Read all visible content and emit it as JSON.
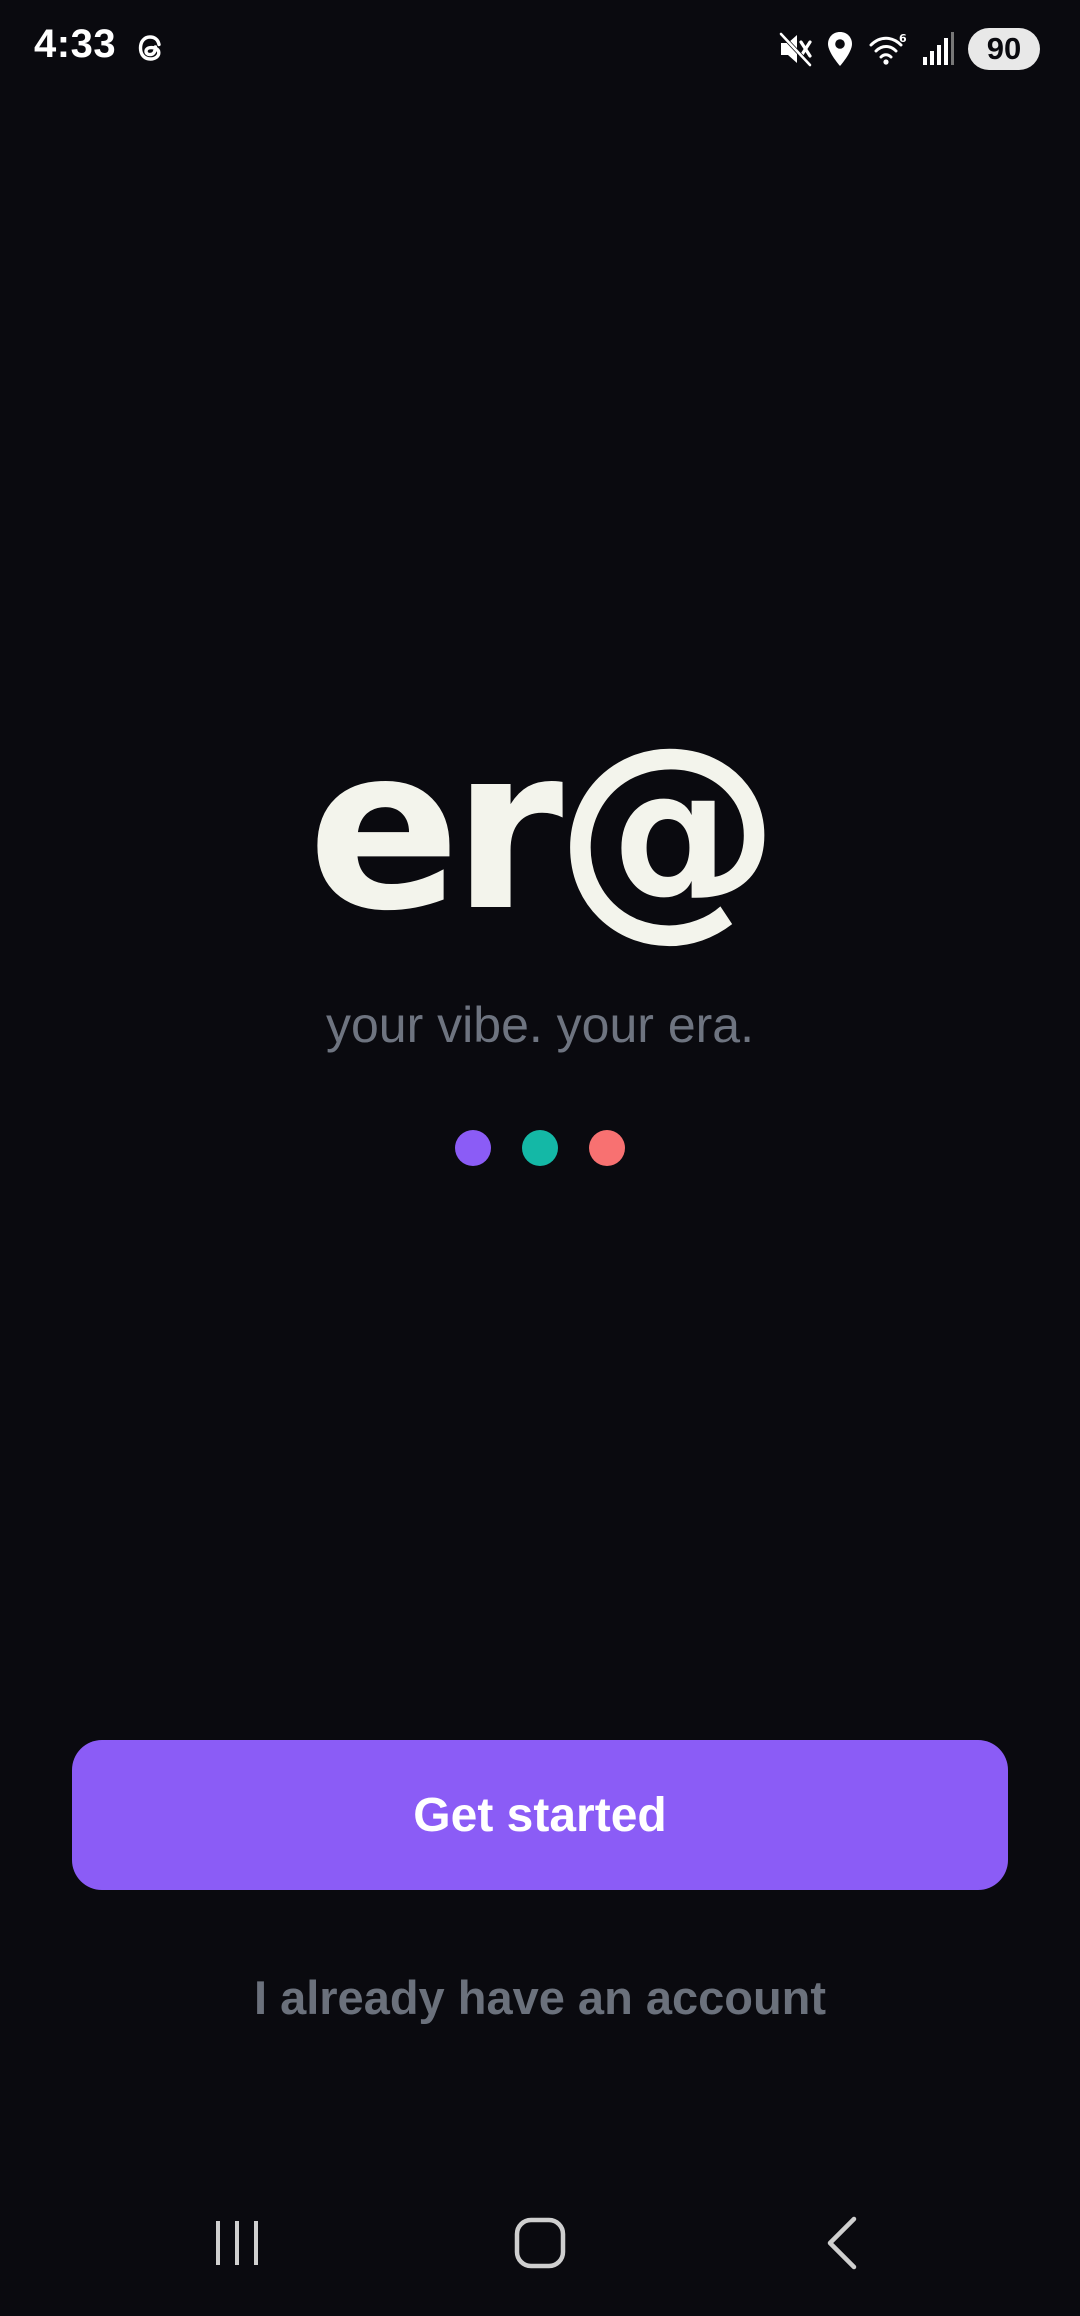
{
  "status_bar": {
    "time": "4:33",
    "battery": "90",
    "icons": [
      "threads-icon",
      "mute-icon",
      "location-icon",
      "wifi-icon",
      "signal-icon"
    ]
  },
  "brand": {
    "logo_text": "er@",
    "tagline": "your vibe. your era."
  },
  "dots": [
    {
      "name": "purple",
      "color": "#8b5cf6"
    },
    {
      "name": "teal",
      "color": "#14b8a6"
    },
    {
      "name": "coral",
      "color": "#f87171"
    }
  ],
  "actions": {
    "primary_label": "Get started",
    "primary_color": "#8b5cf6",
    "secondary_label": "I already have an account"
  },
  "nav": {
    "icons": [
      "recent-apps-icon",
      "home-icon",
      "back-icon"
    ]
  }
}
